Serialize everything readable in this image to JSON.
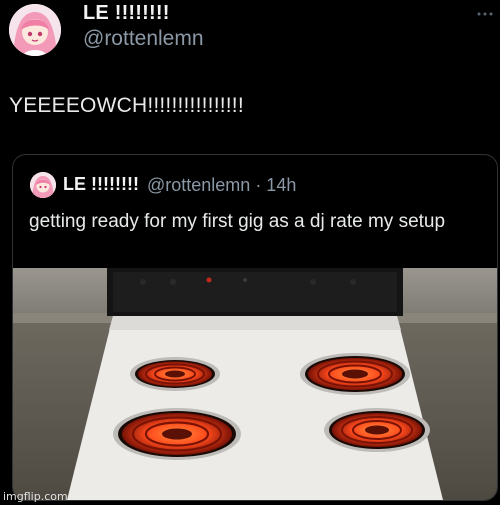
{
  "tweet": {
    "display_name": "LE !!!!!!!!",
    "handle": "@rottenlemn",
    "text": "YEEEEOWCH!!!!!!!!!!!!!!!!",
    "more_icon": "more-horizontal-icon"
  },
  "quoted_tweet": {
    "display_name": "LE !!!!!!!!",
    "handle_time": "@rottenlemn · 14h",
    "text": "getting ready for my first gig as a dj rate my setup",
    "media": "photo of electric stove with four glowing red burners"
  },
  "watermark": "imgflip.com",
  "colors": {
    "background": "#000000",
    "text": "#e7e9ea",
    "secondary": "#8b98a5",
    "burner": "#ff4a1c"
  }
}
